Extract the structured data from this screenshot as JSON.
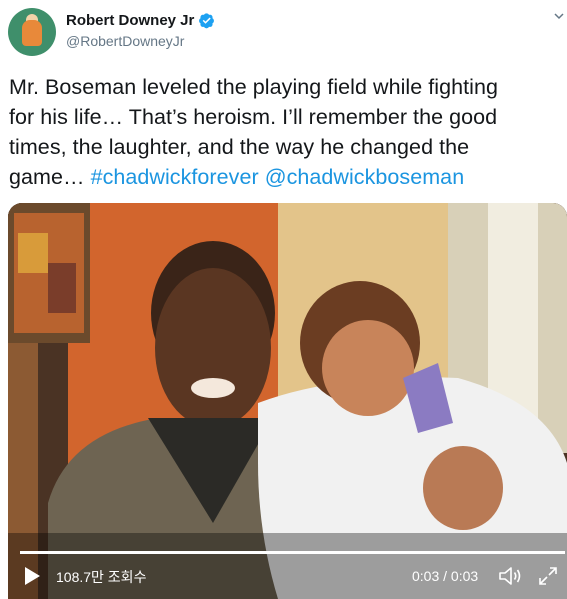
{
  "author": {
    "display_name": "Robert Downey Jr",
    "handle": "@RobertDowneyJr"
  },
  "tweet": {
    "line1": "Mr. Boseman leveled the playing field while fighting",
    "line2": "for his life… That’s heroism. I’ll remember the good",
    "line3": "times, the laughter, and the way he changed the",
    "line4_text": "game… ",
    "hashtag": "#chadwickforever",
    "mention": "@chadwickboseman"
  },
  "video": {
    "view_count": "108.7만 조회수",
    "time_display": "0:03 / 0:03",
    "progress": 1.0
  },
  "colors": {
    "link": "#1b95e0",
    "verified": "#1da1f2"
  },
  "icons": [
    "verified-badge-icon",
    "caret-down-icon",
    "play-icon",
    "volume-icon",
    "fullscreen-icon"
  ]
}
